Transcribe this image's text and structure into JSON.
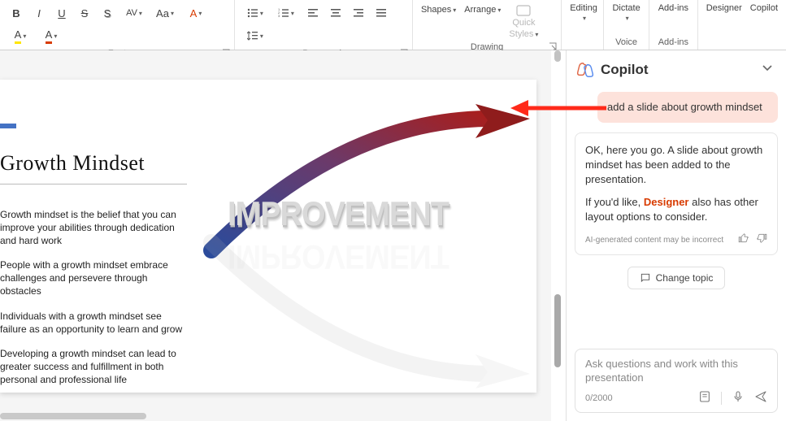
{
  "ribbon": {
    "font": {
      "label": "Font",
      "bold": "B",
      "italic": "I",
      "underline": "U",
      "strike": "S",
      "shadow": "S",
      "spacing": "AV",
      "casechg": "Aa",
      "clear": "A",
      "fontcolor": "A",
      "highlight": "A"
    },
    "paragraph": {
      "label": "Paragraph"
    },
    "drawing": {
      "label": "Drawing",
      "shapes": "Shapes",
      "arrange": "Arrange",
      "quick": "Quick",
      "styles": "Styles"
    },
    "editing": {
      "label": "Editing",
      "btn": "Editing"
    },
    "voice": {
      "label": "Voice",
      "dictate": "Dictate"
    },
    "addins": {
      "label": "Add-ins",
      "btn": "Add-ins"
    },
    "designer": "Designer",
    "copilot": "Copilot"
  },
  "slide": {
    "title": "Growth Mindset",
    "b1": "Growth mindset is the belief that you can improve your abilities through dedication and hard work",
    "b2": "People with a growth mindset embrace challenges and persevere through obstacles",
    "b3": "Individuals with a growth mindset see failure as an opportunity to learn and grow",
    "b4": "Developing a growth mindset can lead to greater success and fulfillment in both personal and professional life",
    "graphic_word": "IMPROVEMENT"
  },
  "copilotPane": {
    "title": "Copilot",
    "user_msg": "add a slide about growth mindset",
    "ai_p1": "OK, here you go. A slide about growth mindset has been added to the presentation.",
    "ai_p2a": "If you'd like, ",
    "ai_p2_link": "Designer",
    "ai_p2b": " also has other layout options to consider.",
    "disclaimer": "AI-generated content may be incorrect",
    "change_topic": "Change topic",
    "compose_ph": "Ask questions and work with this presentation",
    "counter": "0/2000"
  }
}
